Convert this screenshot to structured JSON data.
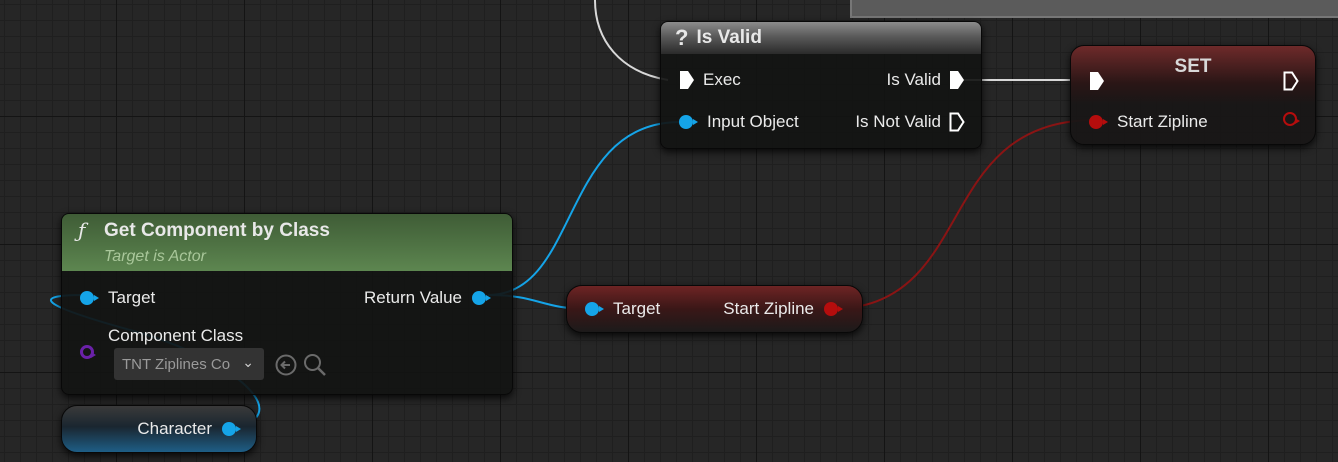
{
  "is_valid_node": {
    "title": "Is Valid",
    "pin_exec": "Exec",
    "pin_input_object": "Input Object",
    "pin_is_valid": "Is Valid",
    "pin_is_not_valid": "Is Not Valid",
    "icon": "question-icon"
  },
  "set_node": {
    "title": "SET",
    "pin_start_zipline": "Start Zipline"
  },
  "get_component_node": {
    "title": "Get Component by Class",
    "subtitle": "Target is Actor",
    "pin_target": "Target",
    "pin_component_class": "Component Class",
    "pin_return_value": "Return Value",
    "class_value": "TNT Ziplines Co",
    "icon": "function-icon"
  },
  "start_zipline_getter": {
    "pin_target": "Target",
    "pin_output": "Start Zipline"
  },
  "character_node": {
    "label": "Character"
  },
  "colors": {
    "object_pin": "#15a4e8",
    "bool_pin": "#b50d0d",
    "class_pin": "#6a21a8",
    "exec_wire": "#d8d8d8",
    "function_header": "#5b7f4f",
    "variable_header": "#7e2121"
  }
}
